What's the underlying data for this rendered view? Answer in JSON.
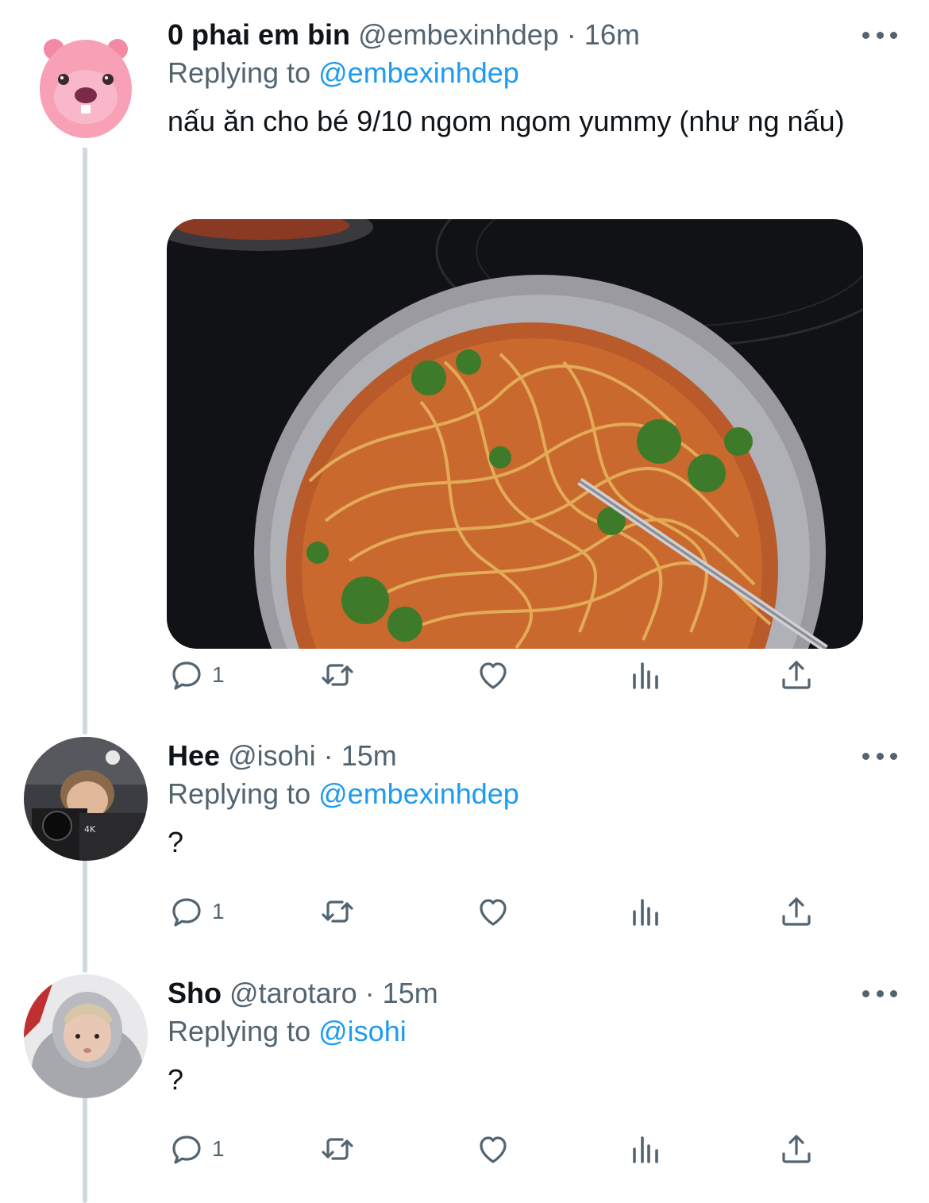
{
  "tweets": [
    {
      "name": "0 phai em bin",
      "handle": "@embexinhdep",
      "separator": "·",
      "time": "16m",
      "replying_prefix": "Replying to",
      "replying_to": "@embexinhdep",
      "text": "nấu ăn cho bé 9/10 ngom ngom yummy (như ng nấu)",
      "reply_count": "1",
      "avatar": "pink-beaver-avatar",
      "has_photo": true,
      "photo": "spaghetti-in-pan"
    },
    {
      "name": "Hee",
      "handle": "@isohi",
      "separator": "·",
      "time": "15m",
      "replying_prefix": "Replying to",
      "replying_to": "@embexinhdep",
      "text": "?",
      "reply_count": "1",
      "avatar": "person-with-camera-avatar"
    },
    {
      "name": "Sho",
      "handle": "@tarotaro",
      "separator": "·",
      "time": "15m",
      "replying_prefix": "Replying to",
      "replying_to": "@isohi",
      "text": "?",
      "reply_count": "1",
      "avatar": "person-in-hoodie-avatar"
    }
  ],
  "colors": {
    "text_primary": "#0f1419",
    "text_secondary": "#536471",
    "link": "#1d9bf0",
    "thread_line": "#cfd9de"
  },
  "icons": [
    "reply-icon",
    "retweet-icon",
    "like-icon",
    "views-icon",
    "share-icon",
    "more-icon"
  ]
}
